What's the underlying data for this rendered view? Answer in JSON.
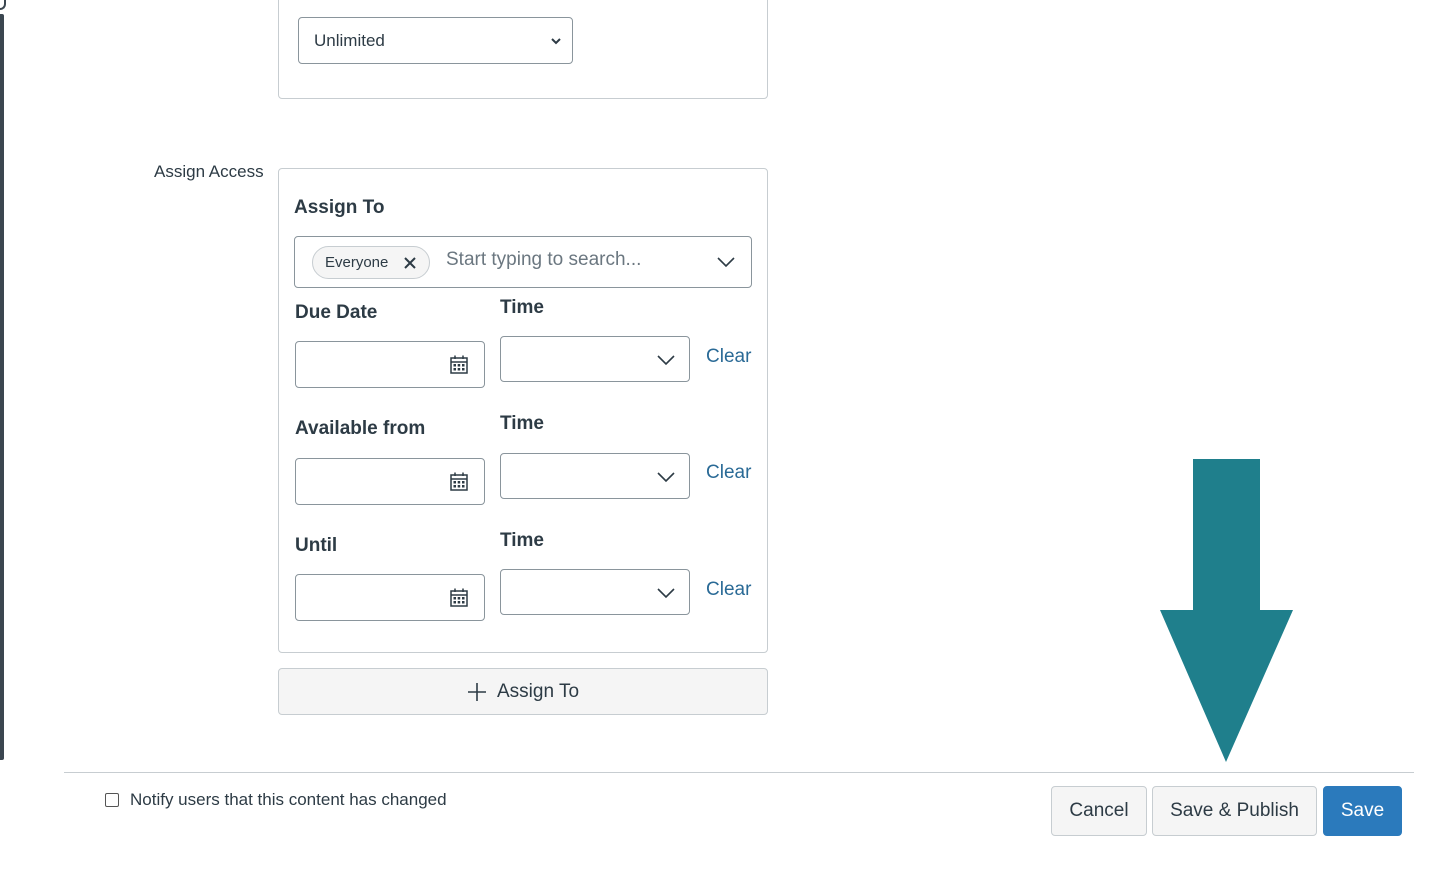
{
  "attempts_select": {
    "value": "Unlimited"
  },
  "assign_access": {
    "section_label": "Assign Access",
    "assign_to_label": "Assign To",
    "assignee_pill": "Everyone",
    "search_placeholder": "Start typing to search...",
    "due_date_label": "Due Date",
    "available_from_label": "Available from",
    "until_label": "Until",
    "time_label": "Time",
    "clear_label": "Clear",
    "add_assign_label": "Assign To"
  },
  "footer": {
    "notify_label": "Notify users that this content has changed",
    "cancel_label": "Cancel",
    "save_publish_label": "Save & Publish",
    "save_label": "Save"
  },
  "colors": {
    "primary": "#2b7abc",
    "link": "#2a6a96",
    "annotation_arrow": "#1f7f8c"
  },
  "icons": [
    "chevron-down-icon",
    "close-icon",
    "calendar-icon",
    "plus-icon",
    "down-arrow-annotation"
  ]
}
